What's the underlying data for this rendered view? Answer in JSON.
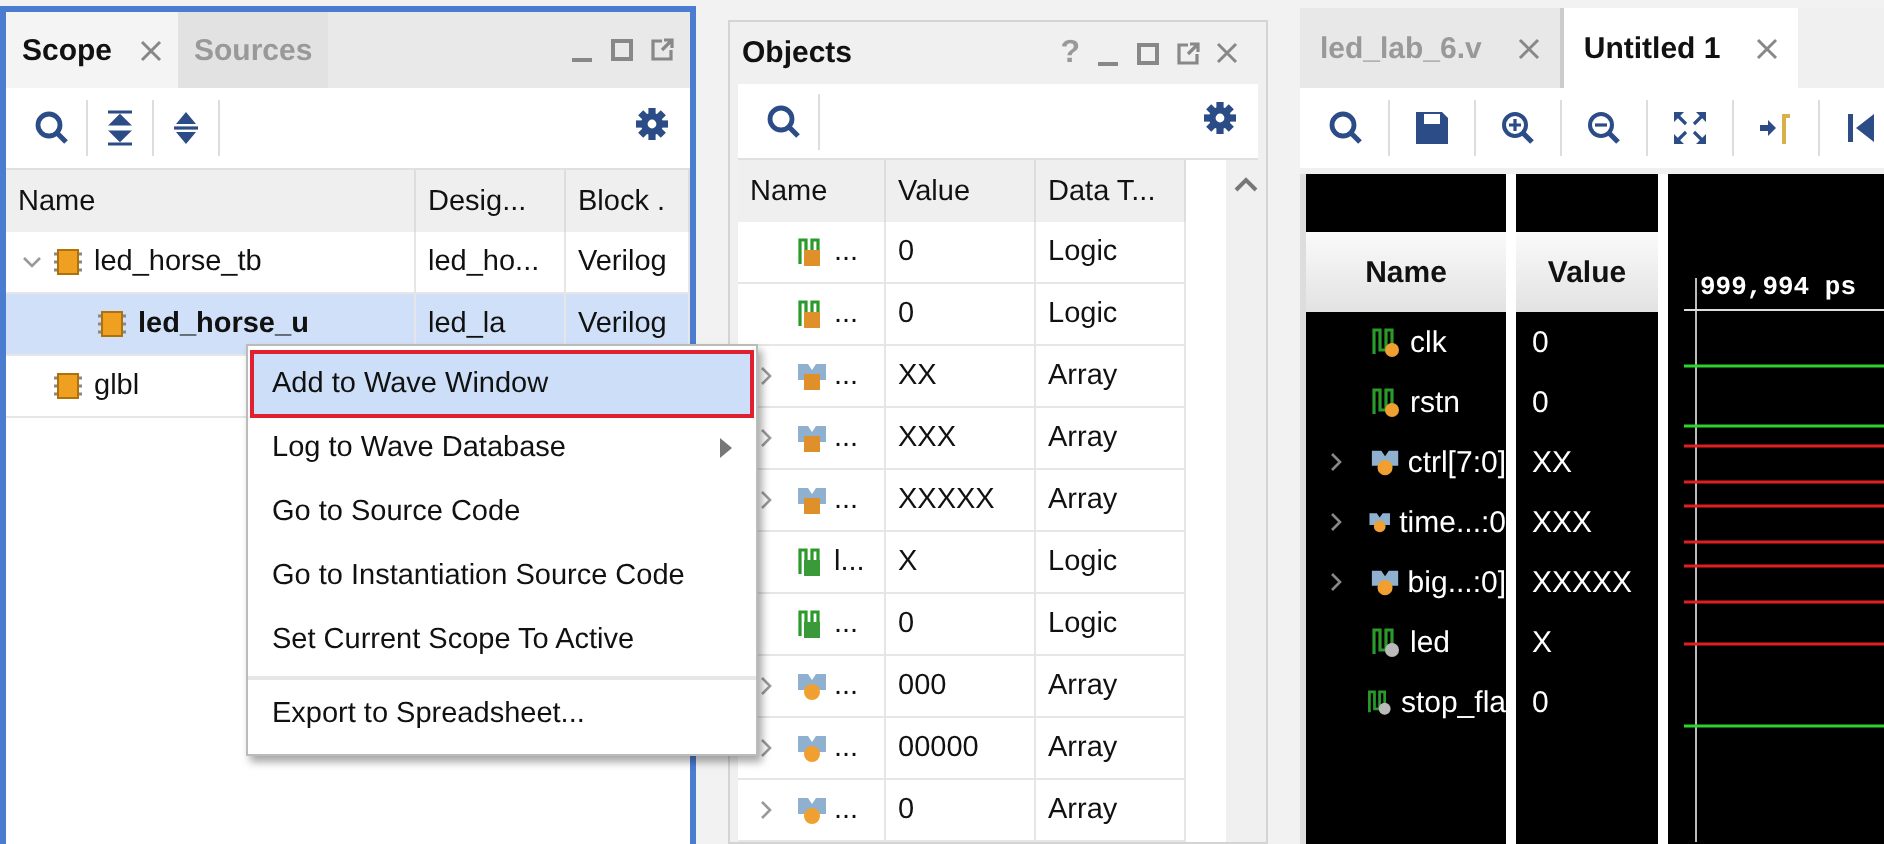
{
  "scope_panel": {
    "tabs": [
      {
        "label": "Scope",
        "selected": true,
        "closable": true
      },
      {
        "label": "Sources",
        "selected": false,
        "closable": false
      }
    ],
    "columns": [
      "Name",
      "Desig...",
      "Block ."
    ],
    "rows": [
      {
        "name": "led_horse_tb",
        "design": "led_ho...",
        "block": "Verilog",
        "selected": false,
        "expanded": true,
        "children": [
          {
            "name": "led_horse_u",
            "design": "led_la",
            "block": "Verilog",
            "selected": true
          }
        ]
      },
      {
        "name": "glbl",
        "selected": false
      }
    ]
  },
  "context_menu": {
    "items": [
      {
        "label": "Add to Wave Window",
        "selected": true,
        "submenu": false,
        "separator_before": false
      },
      {
        "label": "Log to Wave Database",
        "selected": false,
        "submenu": true,
        "separator_before": false
      },
      {
        "label": "Go to Source Code",
        "selected": false,
        "submenu": false,
        "separator_before": false
      },
      {
        "label": "Go to Instantiation Source Code",
        "selected": false,
        "submenu": false,
        "separator_before": false
      },
      {
        "label": "Set Current Scope To Active",
        "selected": false,
        "submenu": false,
        "separator_before": false
      },
      {
        "label": "Export to Spreadsheet...",
        "selected": false,
        "submenu": false,
        "separator_before": true
      }
    ]
  },
  "objects_panel": {
    "title": "Objects",
    "help": "?",
    "columns": [
      "Name",
      "Value",
      "Data T..."
    ],
    "rows": [
      {
        "kind": "in_bit",
        "name": "...",
        "value": "0",
        "type": "Logic",
        "expandable": false
      },
      {
        "kind": "in_bit",
        "name": "...",
        "value": "0",
        "type": "Logic",
        "expandable": false
      },
      {
        "kind": "in_bus",
        "name": "...",
        "value": "XX",
        "type": "Array",
        "expandable": true
      },
      {
        "kind": "in_bus",
        "name": "...",
        "value": "XXX",
        "type": "Array",
        "expandable": true
      },
      {
        "kind": "in_bus",
        "name": "...",
        "value": "XXXXX",
        "type": "Array",
        "expandable": true
      },
      {
        "kind": "out_bit",
        "name": "l...",
        "value": "X",
        "type": "Logic",
        "expandable": false
      },
      {
        "kind": "out_bit",
        "name": "...",
        "value": "0",
        "type": "Logic",
        "expandable": false
      },
      {
        "kind": "var_bus",
        "name": "...",
        "value": "000",
        "type": "Array",
        "expandable": true
      },
      {
        "kind": "var_bus",
        "name": "...",
        "value": "00000",
        "type": "Array",
        "expandable": true
      },
      {
        "kind": "var_bus",
        "name": "...",
        "value": "0",
        "type": "Array",
        "expandable": true
      }
    ]
  },
  "wave_panel": {
    "tabs": [
      {
        "label": "led_lab_6.v",
        "selected": false
      },
      {
        "label": "Untitled 1",
        "selected": true
      }
    ],
    "columns": [
      "Name",
      "Value"
    ],
    "cursor_time": "999,994 ps",
    "signals": [
      {
        "kind": "bit_reg",
        "name": "clk",
        "value": "0",
        "unknown": false,
        "expandable": false
      },
      {
        "kind": "bit_reg",
        "name": "rstn",
        "value": "0",
        "unknown": false,
        "expandable": false
      },
      {
        "kind": "bus_reg",
        "name": "ctrl[7:0]",
        "value": "XX",
        "unknown": true,
        "expandable": true
      },
      {
        "kind": "bus_reg",
        "name": "time...:0",
        "value": "XXX",
        "unknown": true,
        "expandable": true
      },
      {
        "kind": "bus_reg",
        "name": "big...:0]",
        "value": "XXXXX",
        "unknown": true,
        "expandable": true
      },
      {
        "kind": "bit_wire",
        "name": "led",
        "value": "X",
        "unknown": true,
        "expandable": false
      },
      {
        "kind": "bit_wire",
        "name": "stop_fla",
        "value": "0",
        "unknown": false,
        "expandable": false
      }
    ]
  }
}
